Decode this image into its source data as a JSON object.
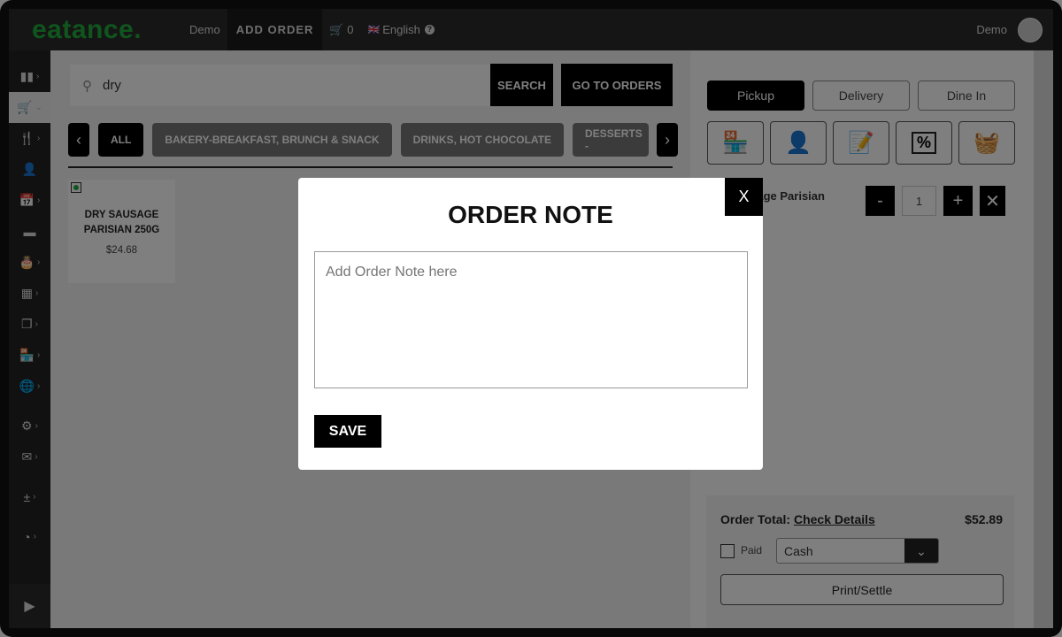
{
  "header": {
    "logo": "eatance",
    "user_link": "Demo",
    "add_order": "ADD ORDER",
    "cart_count": "0",
    "language": "English",
    "user_name": "Demo"
  },
  "sidebar": {
    "items": [
      "chart-bar-icon",
      "cart-icon",
      "utensils-icon",
      "user-icon",
      "calendar-icon",
      "card-icon",
      "cake-icon",
      "table-icon",
      "pages-icon",
      "store-icon",
      "globe-icon",
      "settings-icon",
      "mail-icon",
      "plus-minus-icon",
      "support-icon"
    ],
    "bottom": "play-icon"
  },
  "main": {
    "search": {
      "value": "dry",
      "button": "SEARCH"
    },
    "go_to_orders": "GO TO ORDERS",
    "categories": [
      "ALL",
      "BAKERY-BREAKFAST, BRUNCH & SNACK",
      "DRINKS, HOT CHOCOLATE",
      "DESSERTS -"
    ],
    "product": {
      "name": "DRY SAUSAGE PARISIAN 250G",
      "price": "$24.68"
    }
  },
  "right": {
    "order_types": [
      "Pickup",
      "Delivery",
      "Dine In"
    ],
    "selected_type": "Pickup",
    "icons": [
      "store-icon",
      "customer-icon",
      "note-icon",
      "coupon-icon",
      "basket-icon"
    ],
    "line_item": {
      "name": "Dry Sausage Parisian",
      "qty": "1"
    },
    "order_total_label": "Order Total:",
    "check_details": "Check Details",
    "total": "$52.89",
    "paid_label": "Paid",
    "payment_method": "Cash",
    "print_settle": "Print/Settle"
  },
  "modal": {
    "title": "ORDER NOTE",
    "close": "X",
    "placeholder": "Add Order Note here",
    "save": "SAVE"
  }
}
